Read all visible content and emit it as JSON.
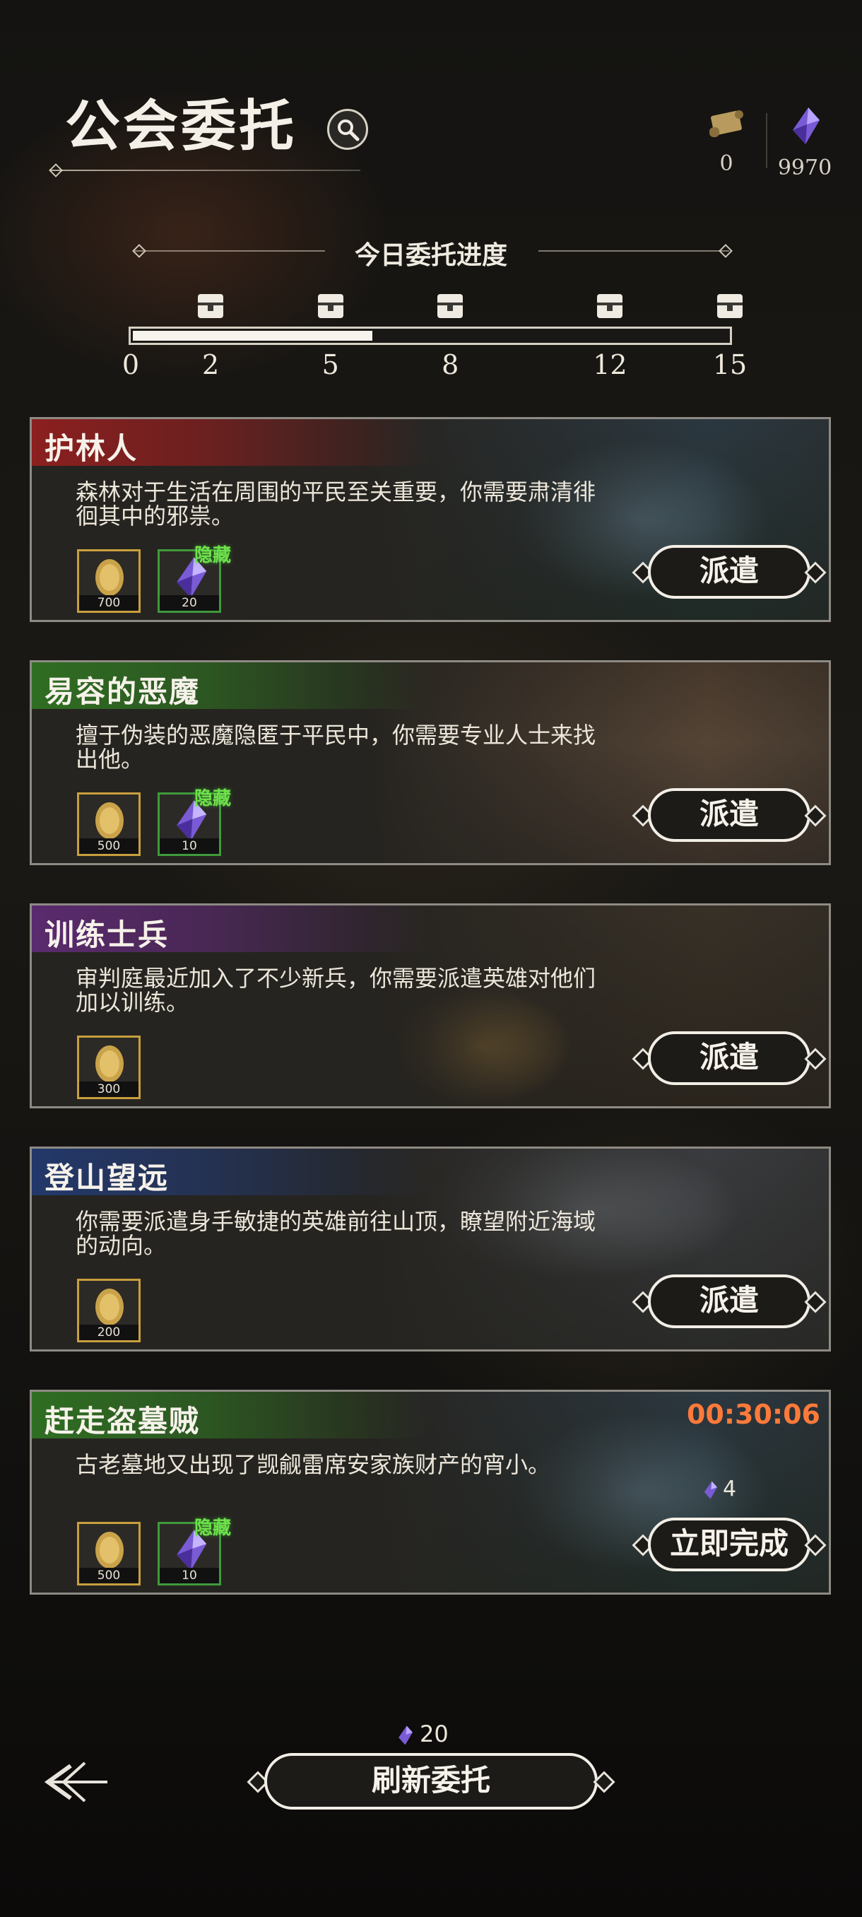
{
  "header": {
    "title": "公会委托",
    "currencies": [
      {
        "icon": "scroll-icon",
        "value": "0"
      },
      {
        "icon": "crystal-icon",
        "value": "9970"
      }
    ]
  },
  "progress": {
    "title": "今日委托进度",
    "current": 6,
    "max": 15,
    "ticks": [
      "0",
      "2",
      "5",
      "8",
      "12",
      "15"
    ],
    "milestones": [
      2,
      5,
      8,
      12,
      15
    ]
  },
  "quests": [
    {
      "title": "护林人",
      "color": "#8c1f1f",
      "description": "森林对于生活在周围的平民至关重要，你需要肃清徘徊其中的邪祟。",
      "rewards": [
        {
          "type": "gold",
          "qty": "700"
        },
        {
          "type": "crystal",
          "qty": "20"
        }
      ],
      "hidden_label": "隐藏",
      "action": "派遣"
    },
    {
      "title": "易容的恶魔",
      "color": "#2f6e22",
      "description": "擅于伪装的恶魔隐匿于平民中，你需要专业人士来找出他。",
      "rewards": [
        {
          "type": "gold",
          "qty": "500"
        },
        {
          "type": "crystal",
          "qty": "10"
        }
      ],
      "hidden_label": "隐藏",
      "action": "派遣"
    },
    {
      "title": "训练士兵",
      "color": "#5a2a6e",
      "description": "审判庭最近加入了不少新兵，你需要派遣英雄对他们加以训练。",
      "rewards": [
        {
          "type": "gold",
          "qty": "300"
        }
      ],
      "action": "派遣"
    },
    {
      "title": "登山望远",
      "color": "#23386a",
      "description": "你需要派遣身手敏捷的英雄前往山顶，瞭望附近海域的动向。",
      "rewards": [
        {
          "type": "gold",
          "qty": "200"
        }
      ],
      "action": "派遣"
    },
    {
      "title": "赶走盗墓贼",
      "color": "#2f6e22",
      "description": "古老墓地又出现了觊觎雷席安家族财产的宵小。",
      "rewards": [
        {
          "type": "gold",
          "qty": "500"
        },
        {
          "type": "crystal",
          "qty": "10"
        }
      ],
      "hidden_label": "隐藏",
      "timer": "00:30:06",
      "cost": "4",
      "action": "立即完成"
    }
  ],
  "footer": {
    "refresh_cost": "20",
    "refresh_label": "刷新委托"
  }
}
